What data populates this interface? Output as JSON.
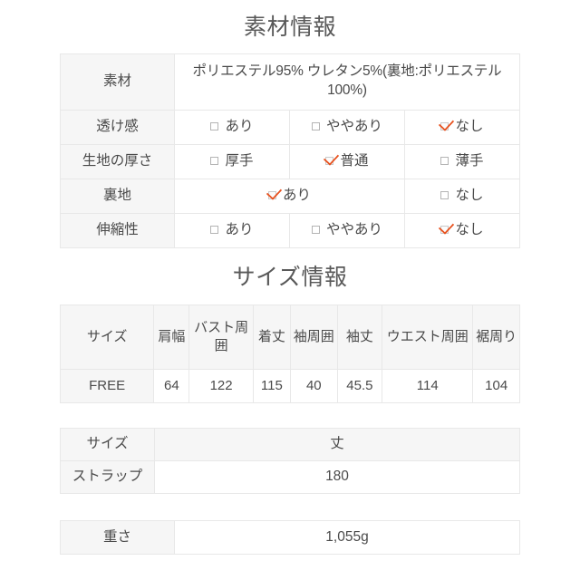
{
  "material_section": {
    "title": "素材情報",
    "rows": {
      "material": {
        "label": "素材",
        "value": "ポリエステル95% ウレタン5%(裏地:ポリエステル100%)"
      },
      "sheerness": {
        "label": "透け感",
        "options": [
          {
            "label": "あり",
            "checked": false
          },
          {
            "label": "ややあり",
            "checked": false
          },
          {
            "label": "なし",
            "checked": true
          }
        ]
      },
      "thickness": {
        "label": "生地の厚さ",
        "options": [
          {
            "label": "厚手",
            "checked": false
          },
          {
            "label": "普通",
            "checked": true
          },
          {
            "label": "薄手",
            "checked": false
          }
        ]
      },
      "lining": {
        "label": "裏地",
        "options": [
          {
            "label": "あり",
            "checked": true
          },
          {
            "label": "なし",
            "checked": false
          }
        ]
      },
      "stretch": {
        "label": "伸縮性",
        "options": [
          {
            "label": "あり",
            "checked": false
          },
          {
            "label": "ややあり",
            "checked": false
          },
          {
            "label": "なし",
            "checked": true
          }
        ]
      }
    }
  },
  "size_section": {
    "title": "サイズ情報",
    "columns": [
      "サイズ",
      "肩幅",
      "バスト周囲",
      "着丈",
      "袖周囲",
      "袖丈",
      "ウエスト周囲",
      "裾周り"
    ],
    "rows": [
      [
        "FREE",
        "64",
        "122",
        "115",
        "40",
        "45.5",
        "114",
        "104"
      ]
    ]
  },
  "strap_section": {
    "columns": [
      "サイズ",
      "丈"
    ],
    "rows": [
      [
        "ストラップ",
        "180"
      ]
    ]
  },
  "weight_section": {
    "label": "重さ",
    "value": "1,055g"
  },
  "colors": {
    "material_text": "#ef7eaa",
    "check_mark": "#e8521f",
    "header_bg": "#f6f6f6",
    "border": "#e8e8e8",
    "title_text": "#595959"
  }
}
